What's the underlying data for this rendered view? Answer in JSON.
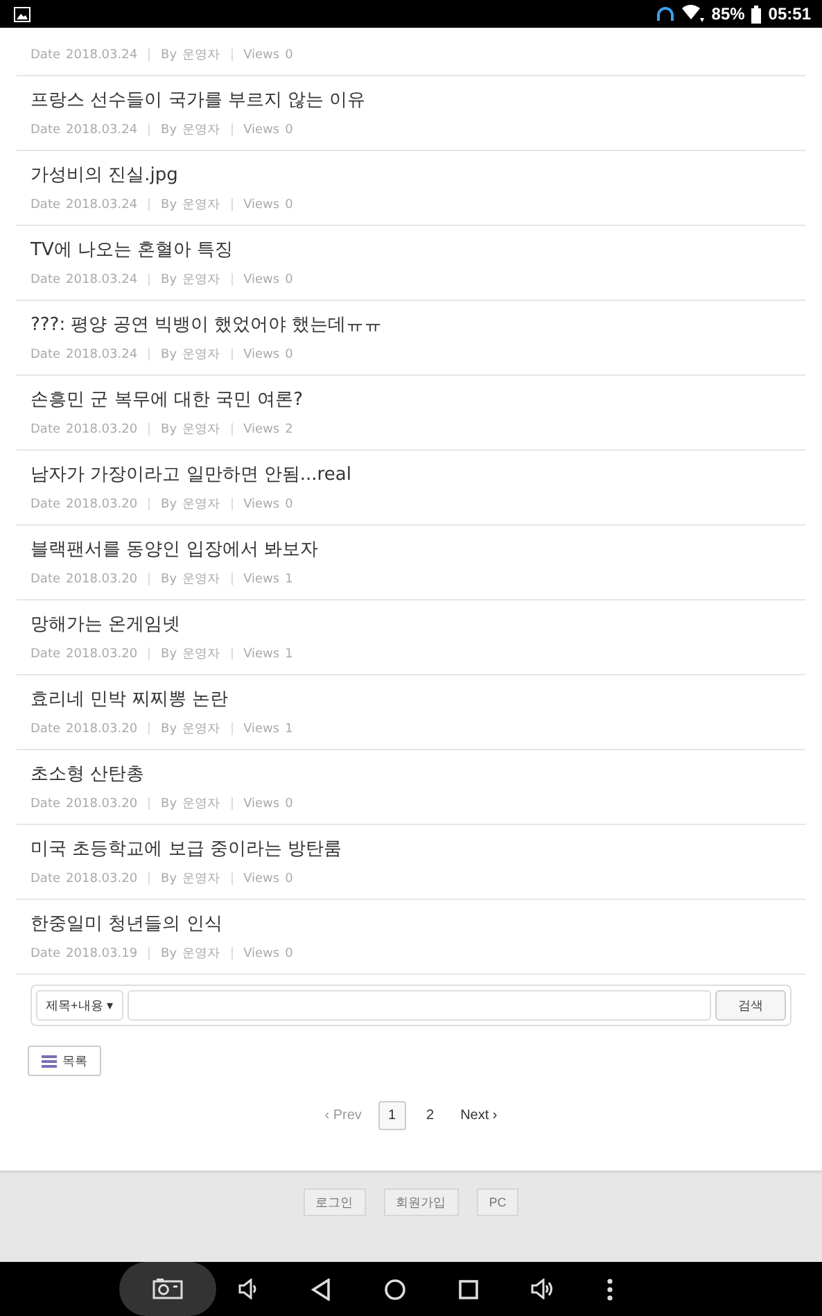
{
  "status_bar": {
    "battery": "85%",
    "time": "05:51"
  },
  "posts": [
    {
      "date_label": "Date",
      "date": "2018.03.24",
      "by_label": "By",
      "author": "운영자",
      "views_label": "Views",
      "views": "0"
    },
    {
      "title": "프랑스 선수들이 국가를 부르지 않는 이유",
      "date_label": "Date",
      "date": "2018.03.24",
      "by_label": "By",
      "author": "운영자",
      "views_label": "Views",
      "views": "0"
    },
    {
      "title": "가성비의 진실.jpg",
      "date_label": "Date",
      "date": "2018.03.24",
      "by_label": "By",
      "author": "운영자",
      "views_label": "Views",
      "views": "0"
    },
    {
      "title": "TV에 나오는 혼혈아 특징",
      "date_label": "Date",
      "date": "2018.03.24",
      "by_label": "By",
      "author": "운영자",
      "views_label": "Views",
      "views": "0"
    },
    {
      "title": "???: 평양 공연 빅뱅이 했었어야 했는데ㅠㅠ",
      "date_label": "Date",
      "date": "2018.03.24",
      "by_label": "By",
      "author": "운영자",
      "views_label": "Views",
      "views": "0"
    },
    {
      "title": "손흥민 군 복무에 대한 국민 여론?",
      "date_label": "Date",
      "date": "2018.03.20",
      "by_label": "By",
      "author": "운영자",
      "views_label": "Views",
      "views": "2"
    },
    {
      "title": "남자가 가장이라고 일만하면 안됨...real",
      "date_label": "Date",
      "date": "2018.03.20",
      "by_label": "By",
      "author": "운영자",
      "views_label": "Views",
      "views": "0"
    },
    {
      "title": "블랙팬서를 동양인 입장에서 봐보자",
      "date_label": "Date",
      "date": "2018.03.20",
      "by_label": "By",
      "author": "운영자",
      "views_label": "Views",
      "views": "1"
    },
    {
      "title": "망해가는 온게임넷",
      "date_label": "Date",
      "date": "2018.03.20",
      "by_label": "By",
      "author": "운영자",
      "views_label": "Views",
      "views": "1"
    },
    {
      "title": "효리네 민박 찌찌뽕 논란",
      "date_label": "Date",
      "date": "2018.03.20",
      "by_label": "By",
      "author": "운영자",
      "views_label": "Views",
      "views": "1"
    },
    {
      "title": "초소형 산탄총",
      "date_label": "Date",
      "date": "2018.03.20",
      "by_label": "By",
      "author": "운영자",
      "views_label": "Views",
      "views": "0"
    },
    {
      "title": "미국 초등학교에 보급 중이라는 방탄룸",
      "date_label": "Date",
      "date": "2018.03.20",
      "by_label": "By",
      "author": "운영자",
      "views_label": "Views",
      "views": "0"
    },
    {
      "title": "한중일미 청년들의 인식",
      "date_label": "Date",
      "date": "2018.03.19",
      "by_label": "By",
      "author": "운영자",
      "views_label": "Views",
      "views": "0"
    }
  ],
  "search": {
    "scope": "제목+내용 ▾",
    "button": "검색"
  },
  "list_button": "목록",
  "pagination": {
    "prev": "‹ Prev",
    "pages": [
      {
        "label": "1",
        "selected": true
      },
      {
        "label": "2",
        "selected": false
      }
    ],
    "next": "Next ›"
  },
  "footer_links": [
    "로그인",
    "회원가입",
    "PC"
  ]
}
